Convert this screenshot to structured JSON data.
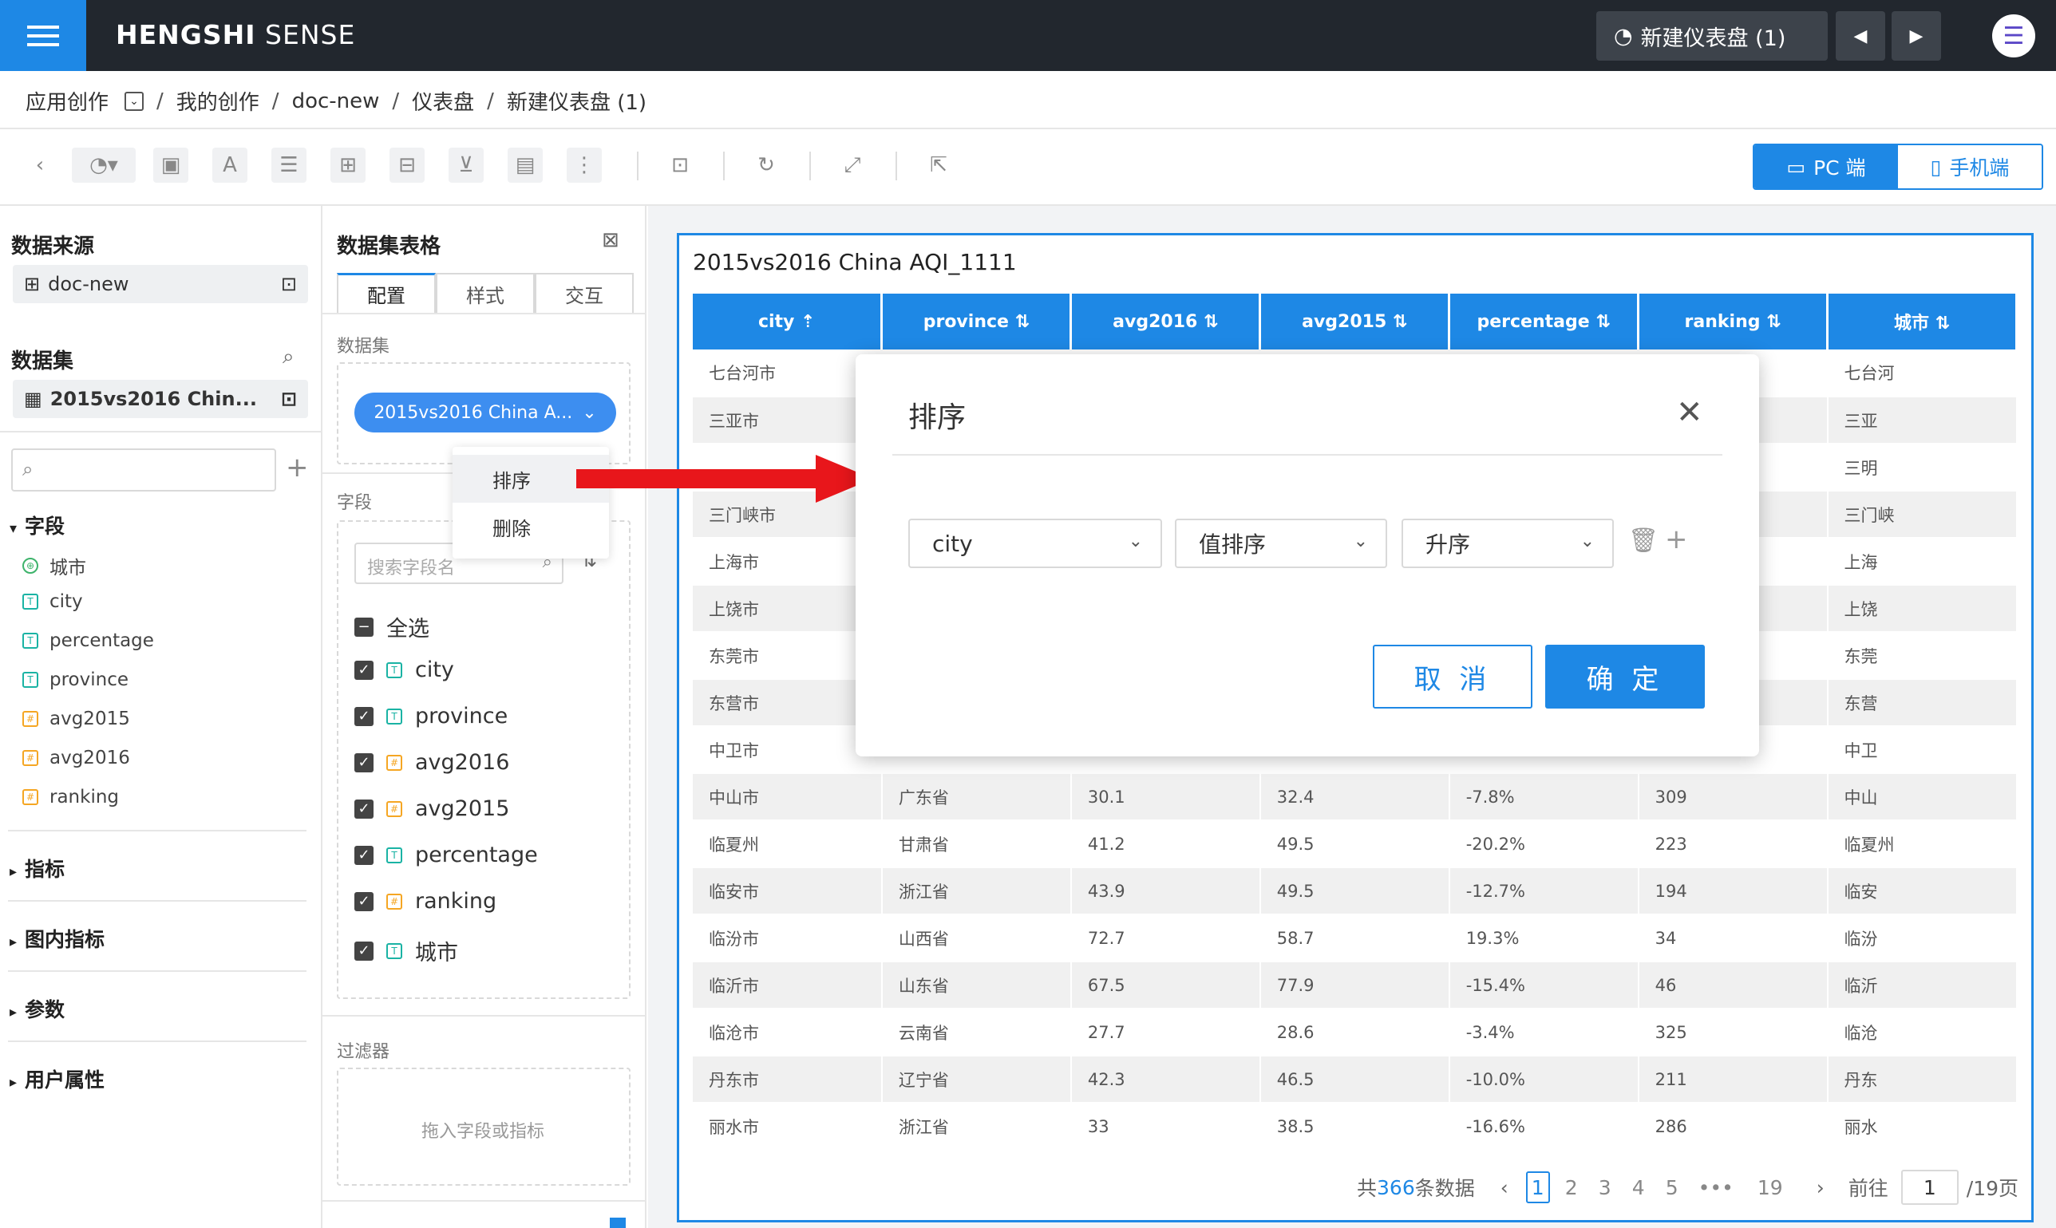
{
  "app": {
    "logo_bold": "HENGSHI",
    "logo_rest": " SENSE",
    "dashboard_pill": "新建仪表盘 (1)"
  },
  "breadcrumb": [
    "应用创作",
    "我的创作",
    "doc-new",
    "仪表盘",
    "新建仪表盘 (1)"
  ],
  "view_toggle": {
    "pc": "PC 端",
    "mobile": "手机端"
  },
  "left": {
    "source_title": "数据来源",
    "source_name": "doc-new",
    "dataset_title": "数据集",
    "dataset_name": "2015vs2016 Chin...",
    "fields_title": "字段",
    "fields": [
      {
        "name": "城市",
        "type": "geo"
      },
      {
        "name": "city",
        "type": "text"
      },
      {
        "name": "percentage",
        "type": "text"
      },
      {
        "name": "province",
        "type": "text"
      },
      {
        "name": "avg2015",
        "type": "number"
      },
      {
        "name": "avg2016",
        "type": "number"
      },
      {
        "name": "ranking",
        "type": "number"
      }
    ],
    "groups": [
      "指标",
      "图内指标",
      "参数",
      "用户属性"
    ]
  },
  "middle": {
    "title": "数据集表格",
    "tabs": [
      "配置",
      "样式",
      "交互"
    ],
    "dataset_label": "数据集",
    "dataset_pill": "2015vs2016 China A...",
    "fields_label": "字段",
    "search_placeholder": "搜索字段名",
    "select_all": "全选",
    "checked_fields": [
      {
        "name": "city",
        "type": "text"
      },
      {
        "name": "province",
        "type": "text"
      },
      {
        "name": "avg2016",
        "type": "number"
      },
      {
        "name": "avg2015",
        "type": "number"
      },
      {
        "name": "percentage",
        "type": "text"
      },
      {
        "name": "ranking",
        "type": "number"
      },
      {
        "name": "城市",
        "type": "text"
      }
    ],
    "filter_label": "过滤器",
    "filter_drop": "拖入字段或指标",
    "context_menu": [
      "排序",
      "删除"
    ]
  },
  "chart": {
    "title": "2015vs2016 China AQI_1111",
    "columns": [
      "city",
      "province",
      "avg2016",
      "avg2015",
      "percentage",
      "ranking",
      "城市"
    ],
    "rows": [
      [
        "七台河市",
        "",
        "",
        "",
        "",
        "",
        "七台河"
      ],
      [
        "三亚市",
        "",
        "",
        "",
        "",
        "",
        "三亚"
      ],
      [
        "",
        "",
        "",
        "",
        "",
        "",
        "三明"
      ],
      [
        "三门峡市",
        "",
        "",
        "",
        "",
        "",
        "三门峡"
      ],
      [
        "上海市",
        "",
        "",
        "",
        "",
        "",
        "上海"
      ],
      [
        "上饶市",
        "",
        "",
        "",
        "",
        "",
        "上饶"
      ],
      [
        "东莞市",
        "",
        "",
        "",
        "",
        "",
        "东莞"
      ],
      [
        "东营市",
        "",
        "",
        "",
        "",
        "",
        "东营"
      ],
      [
        "中卫市",
        "",
        "",
        "",
        "",
        "",
        "中卫"
      ],
      [
        "中山市",
        "广东省",
        "30.1",
        "32.4",
        "-7.8%",
        "309",
        "中山"
      ],
      [
        "临夏州",
        "甘肃省",
        "41.2",
        "49.5",
        "-20.2%",
        "223",
        "临夏州"
      ],
      [
        "临安市",
        "浙江省",
        "43.9",
        "49.5",
        "-12.7%",
        "194",
        "临安"
      ],
      [
        "临汾市",
        "山西省",
        "72.7",
        "58.7",
        "19.3%",
        "34",
        "临汾"
      ],
      [
        "临沂市",
        "山东省",
        "67.5",
        "77.9",
        "-15.4%",
        "46",
        "临沂"
      ],
      [
        "临沧市",
        "云南省",
        "27.7",
        "28.6",
        "-3.4%",
        "325",
        "临沧"
      ],
      [
        "丹东市",
        "辽宁省",
        "42.3",
        "46.5",
        "-10.0%",
        "211",
        "丹东"
      ],
      [
        "丽水市",
        "浙江省",
        "33",
        "38.5",
        "-16.6%",
        "286",
        "丽水"
      ]
    ],
    "pager": {
      "total_prefix": "共",
      "total": "366",
      "total_suffix": "条数据",
      "pages": [
        "1",
        "2",
        "3",
        "4",
        "5",
        "•••",
        "19"
      ],
      "goto": "前往",
      "current": "1",
      "of": "/19页"
    }
  },
  "dialog": {
    "title": "排序",
    "field": "city",
    "method": "值排序",
    "order": "升序",
    "cancel": "取 消",
    "ok": "确 定"
  }
}
